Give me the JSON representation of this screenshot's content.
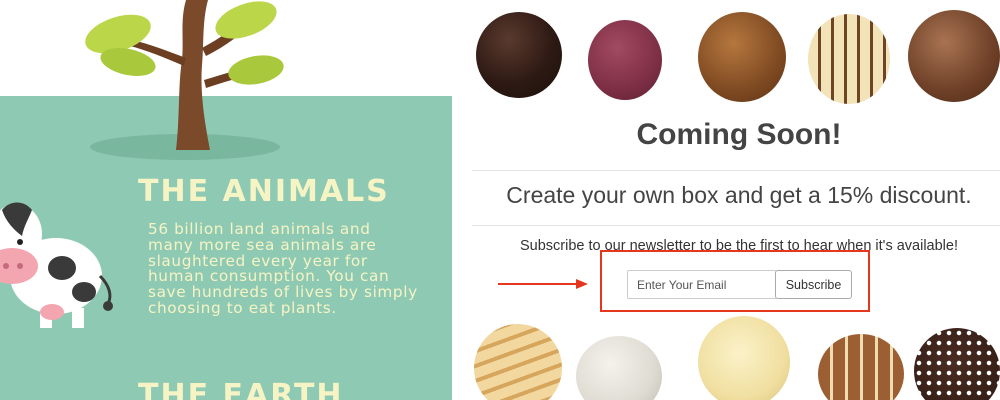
{
  "infographic": {
    "section1_title": "THE ANIMALS",
    "section1_text": "56 billion land animals and many more sea animals are slaughtered every year for human consumption. You can save hundreds of lives by simply choosing to eat plants.",
    "section2_title": "THE EARTH"
  },
  "promo": {
    "heading": "Coming Soon!",
    "offer": "Create your own box and get a 15% discount.",
    "newsletter_prompt": "Subscribe to our newsletter to be the first to hear when it's available!",
    "email_placeholder": "Enter Your Email",
    "subscribe_label": "Subscribe"
  },
  "colors": {
    "mint": "#8ecab3",
    "title_cream": "#f6f3c4",
    "highlight_red": "#e5371e",
    "heading_gray": "#444444"
  },
  "icons": [
    "tree-illustration",
    "cow-illustration",
    "red-arrow-icon"
  ]
}
